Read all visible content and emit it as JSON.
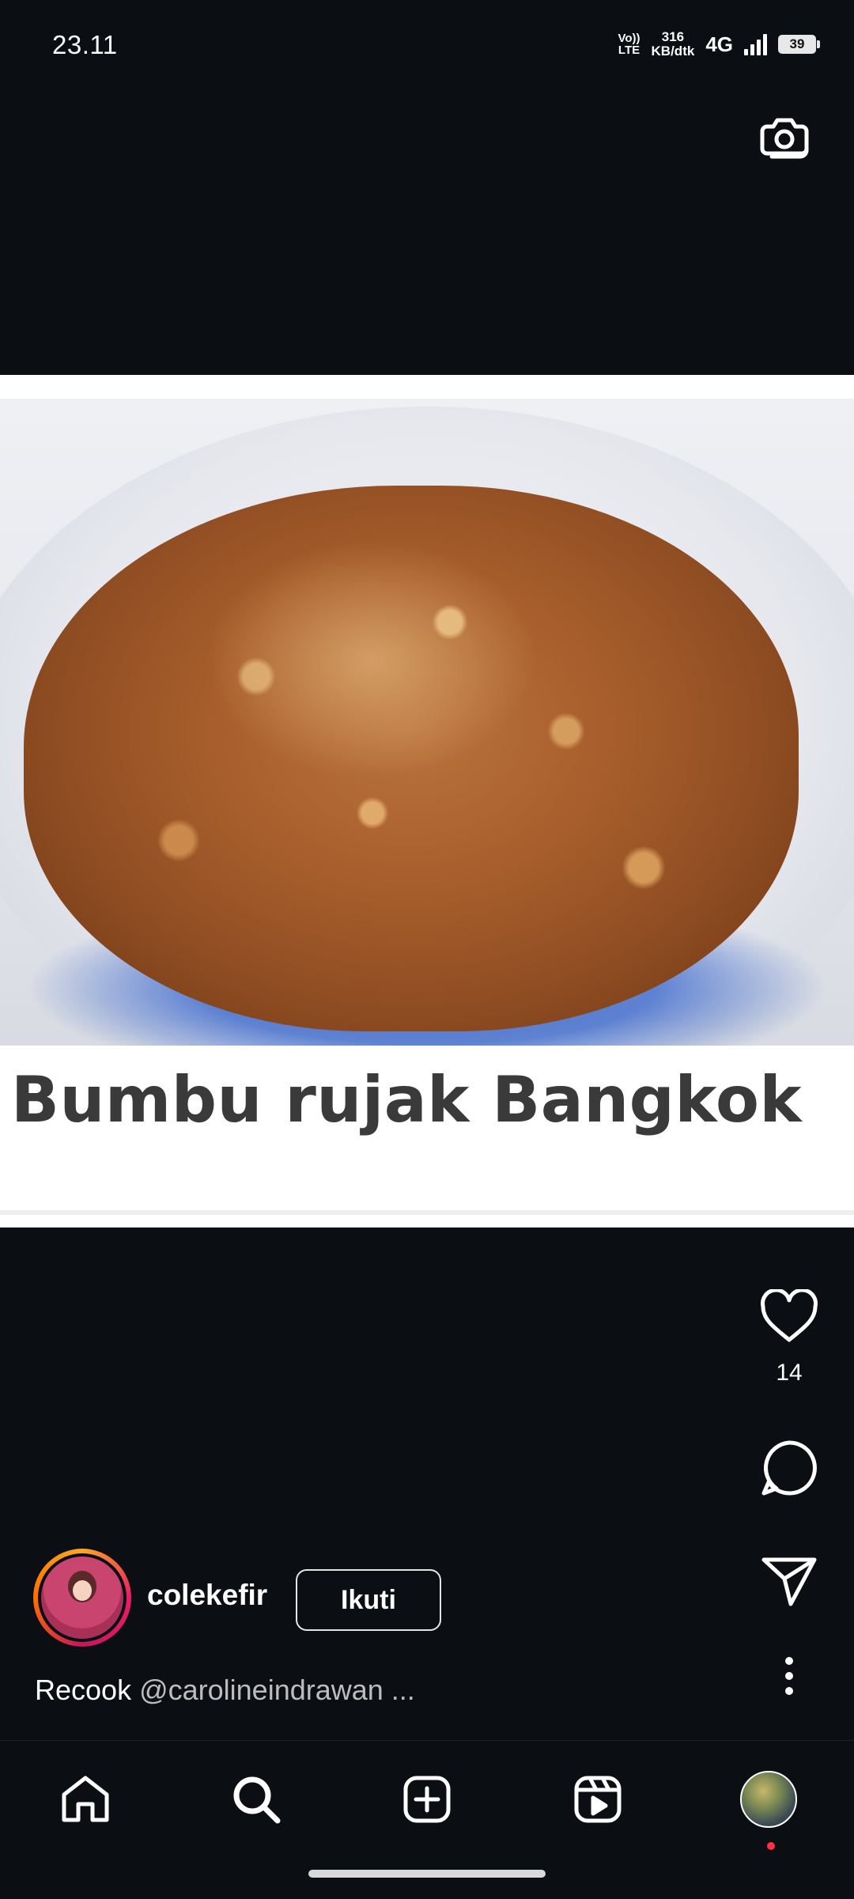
{
  "status_bar": {
    "time": "23.11",
    "volte_line1": "Vo))",
    "volte_line2": "LTE",
    "speed_value": "316",
    "speed_unit": "KB/dtk",
    "network": "4G",
    "battery": "39"
  },
  "post": {
    "image_title": "Bumbu rujak Bangkok",
    "like_count": "14",
    "author": {
      "username": "colekefir",
      "follow_label": "Ikuti"
    },
    "caption": {
      "lead": "Recook",
      "mention": "@carolineindrawan ..."
    }
  },
  "icons": {
    "camera": "camera-icon",
    "like": "heart-icon",
    "comment": "comment-icon",
    "share": "send-icon",
    "more": "more-vertical-icon",
    "nav_home": "home-icon",
    "nav_search": "search-icon",
    "nav_create": "add-post-icon",
    "nav_reels": "reels-icon",
    "nav_profile": "profile-icon"
  },
  "colors": {
    "background": "#0b0e13",
    "notification_dot": "#ff3040"
  }
}
